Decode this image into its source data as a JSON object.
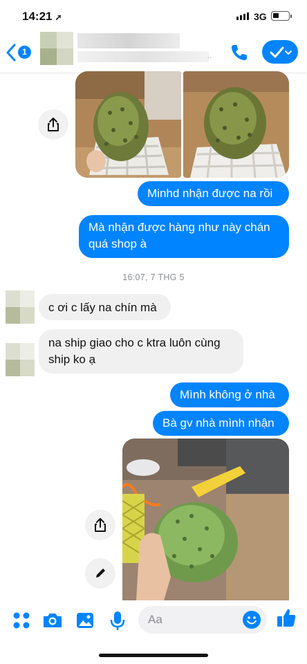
{
  "status_bar": {
    "time": "14:21",
    "network": "3G",
    "battery_level": 0.3
  },
  "header": {
    "unread_count": "1",
    "status_dots": ".."
  },
  "messages": {
    "out_1": "Minhd nhận được na rồi",
    "out_2": "Mà nhận được hàng như này chán quá shop à",
    "timestamp": "16:07, 7 THG 5",
    "in_1": "c ơi c lấy na chín mà",
    "in_2": "na ship giao cho c ktra luôn cùng ship ko ạ",
    "out_3": "Mình không ở nhà",
    "out_4": "Bà gv nhà mình nhận"
  },
  "composer": {
    "placeholder": "Aa"
  },
  "colors": {
    "accent": "#0084ff",
    "incoming_bubble": "#f0f0f0"
  },
  "icons": [
    "back-chevron-icon",
    "phone-icon",
    "check-icon",
    "share-icon",
    "pencil-icon",
    "apps-icon",
    "camera-icon",
    "gallery-icon",
    "microphone-icon",
    "emoji-icon",
    "thumbs-up-icon"
  ]
}
